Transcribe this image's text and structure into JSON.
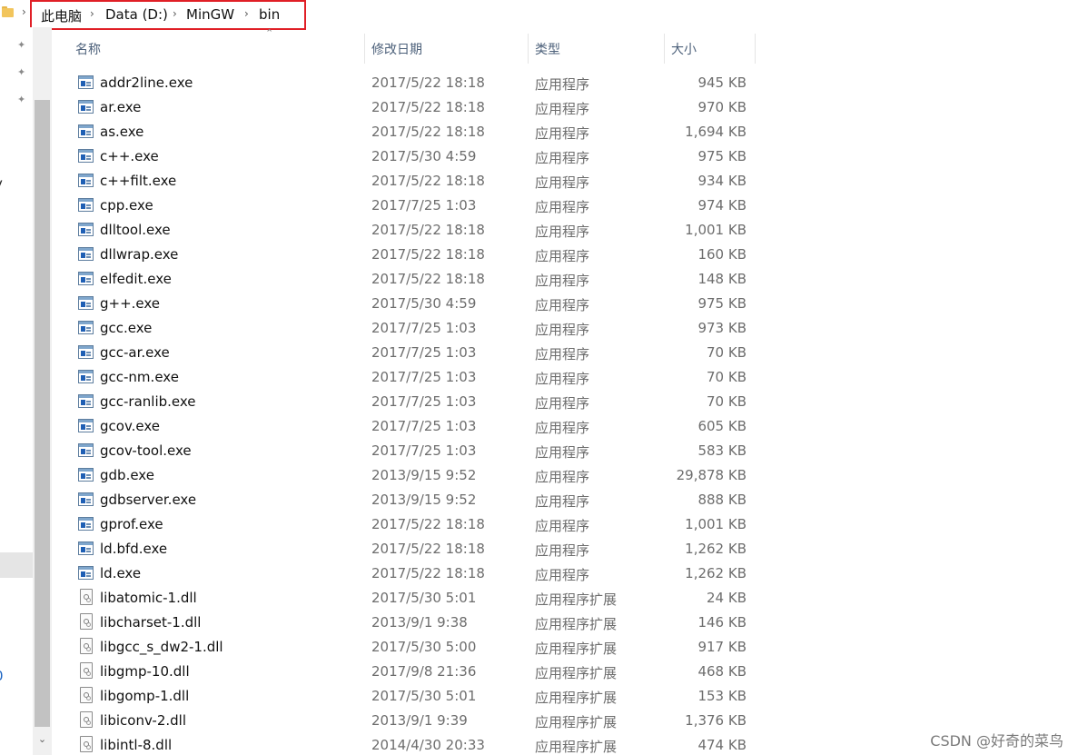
{
  "breadcrumb": {
    "items": [
      "此电脑",
      "Data (D:)",
      "MinGW",
      "bin"
    ]
  },
  "nav": {
    "clipped_labels": [
      "l",
      "y",
      "0"
    ]
  },
  "columns": {
    "name": "名称",
    "date": "修改日期",
    "type": "类型",
    "size": "大小"
  },
  "files": [
    {
      "name": "addr2line.exe",
      "date": "2017/5/22 18:18",
      "type": "应用程序",
      "size": "945 KB",
      "icon": "exe-icon"
    },
    {
      "name": "ar.exe",
      "date": "2017/5/22 18:18",
      "type": "应用程序",
      "size": "970 KB",
      "icon": "exe-icon"
    },
    {
      "name": "as.exe",
      "date": "2017/5/22 18:18",
      "type": "应用程序",
      "size": "1,694 KB",
      "icon": "exe-icon"
    },
    {
      "name": "c++.exe",
      "date": "2017/5/30 4:59",
      "type": "应用程序",
      "size": "975 KB",
      "icon": "exe-icon"
    },
    {
      "name": "c++filt.exe",
      "date": "2017/5/22 18:18",
      "type": "应用程序",
      "size": "934 KB",
      "icon": "exe-icon"
    },
    {
      "name": "cpp.exe",
      "date": "2017/7/25 1:03",
      "type": "应用程序",
      "size": "974 KB",
      "icon": "exe-icon"
    },
    {
      "name": "dlltool.exe",
      "date": "2017/5/22 18:18",
      "type": "应用程序",
      "size": "1,001 KB",
      "icon": "exe-icon"
    },
    {
      "name": "dllwrap.exe",
      "date": "2017/5/22 18:18",
      "type": "应用程序",
      "size": "160 KB",
      "icon": "exe-icon"
    },
    {
      "name": "elfedit.exe",
      "date": "2017/5/22 18:18",
      "type": "应用程序",
      "size": "148 KB",
      "icon": "exe-icon"
    },
    {
      "name": "g++.exe",
      "date": "2017/5/30 4:59",
      "type": "应用程序",
      "size": "975 KB",
      "icon": "exe-icon"
    },
    {
      "name": "gcc.exe",
      "date": "2017/7/25 1:03",
      "type": "应用程序",
      "size": "973 KB",
      "icon": "exe-icon"
    },
    {
      "name": "gcc-ar.exe",
      "date": "2017/7/25 1:03",
      "type": "应用程序",
      "size": "70 KB",
      "icon": "exe-icon"
    },
    {
      "name": "gcc-nm.exe",
      "date": "2017/7/25 1:03",
      "type": "应用程序",
      "size": "70 KB",
      "icon": "exe-icon"
    },
    {
      "name": "gcc-ranlib.exe",
      "date": "2017/7/25 1:03",
      "type": "应用程序",
      "size": "70 KB",
      "icon": "exe-icon"
    },
    {
      "name": "gcov.exe",
      "date": "2017/7/25 1:03",
      "type": "应用程序",
      "size": "605 KB",
      "icon": "exe-icon"
    },
    {
      "name": "gcov-tool.exe",
      "date": "2017/7/25 1:03",
      "type": "应用程序",
      "size": "583 KB",
      "icon": "exe-icon"
    },
    {
      "name": "gdb.exe",
      "date": "2013/9/15 9:52",
      "type": "应用程序",
      "size": "29,878 KB",
      "icon": "exe-icon"
    },
    {
      "name": "gdbserver.exe",
      "date": "2013/9/15 9:52",
      "type": "应用程序",
      "size": "888 KB",
      "icon": "exe-icon"
    },
    {
      "name": "gprof.exe",
      "date": "2017/5/22 18:18",
      "type": "应用程序",
      "size": "1,001 KB",
      "icon": "exe-icon"
    },
    {
      "name": "ld.bfd.exe",
      "date": "2017/5/22 18:18",
      "type": "应用程序",
      "size": "1,262 KB",
      "icon": "exe-icon"
    },
    {
      "name": "ld.exe",
      "date": "2017/5/22 18:18",
      "type": "应用程序",
      "size": "1,262 KB",
      "icon": "exe-icon"
    },
    {
      "name": "libatomic-1.dll",
      "date": "2017/5/30 5:01",
      "type": "应用程序扩展",
      "size": "24 KB",
      "icon": "dll-icon"
    },
    {
      "name": "libcharset-1.dll",
      "date": "2013/9/1 9:38",
      "type": "应用程序扩展",
      "size": "146 KB",
      "icon": "dll-icon"
    },
    {
      "name": "libgcc_s_dw2-1.dll",
      "date": "2017/5/30 5:00",
      "type": "应用程序扩展",
      "size": "917 KB",
      "icon": "dll-icon"
    },
    {
      "name": "libgmp-10.dll",
      "date": "2017/9/8 21:36",
      "type": "应用程序扩展",
      "size": "468 KB",
      "icon": "dll-icon"
    },
    {
      "name": "libgomp-1.dll",
      "date": "2017/5/30 5:01",
      "type": "应用程序扩展",
      "size": "153 KB",
      "icon": "dll-icon"
    },
    {
      "name": "libiconv-2.dll",
      "date": "2013/9/1 9:39",
      "type": "应用程序扩展",
      "size": "1,376 KB",
      "icon": "dll-icon"
    },
    {
      "name": "libintl-8.dll",
      "date": "2014/4/30 20:33",
      "type": "应用程序扩展",
      "size": "474 KB",
      "icon": "dll-icon"
    }
  ],
  "watermark": "CSDN @好奇的菜鸟",
  "colors": {
    "highlight_box": "#e01f26",
    "header_text": "#4c607a",
    "secondary_text": "#6d6d6d"
  }
}
